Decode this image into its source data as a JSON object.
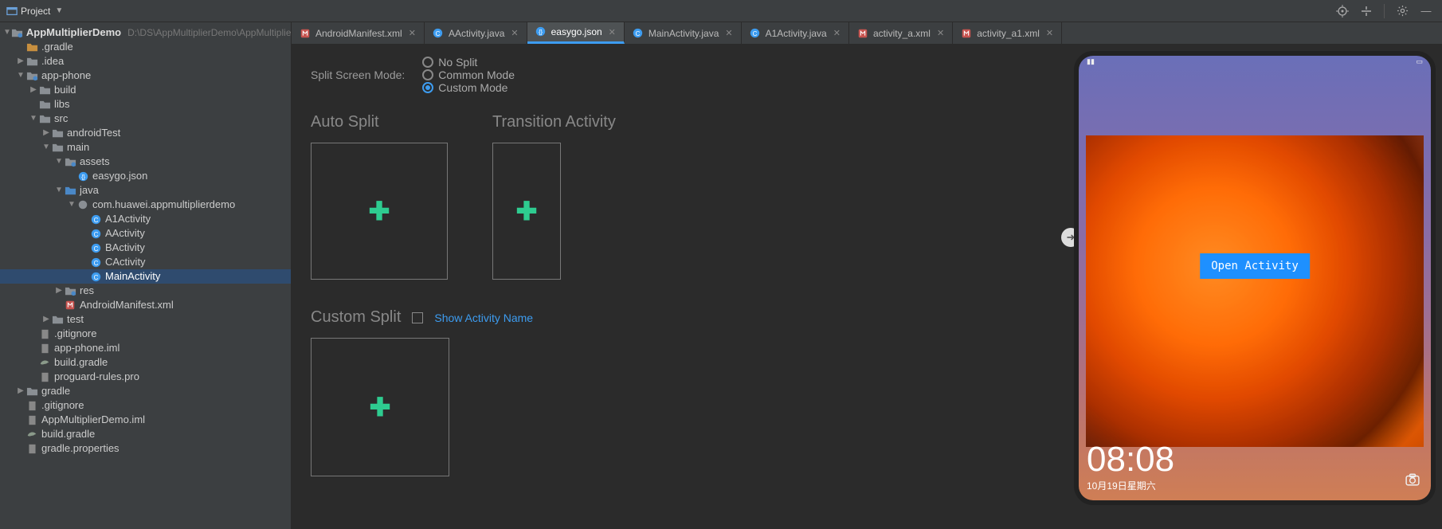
{
  "toolbar": {
    "project": "Project"
  },
  "tree": {
    "root": {
      "name": "AppMultiplierDemo",
      "path": "D:\\DS\\AppMultiplierDemo\\AppMultiplierDemo"
    },
    "items": [
      {
        "indent": 1,
        "arrow": "none",
        "icon": "folder-orange",
        "label": ".gradle"
      },
      {
        "indent": 1,
        "arrow": "right",
        "icon": "folder",
        "label": ".idea"
      },
      {
        "indent": 1,
        "arrow": "down",
        "icon": "module",
        "label": "app-phone"
      },
      {
        "indent": 2,
        "arrow": "right",
        "icon": "folder",
        "label": "build"
      },
      {
        "indent": 2,
        "arrow": "none",
        "icon": "folder",
        "label": "libs"
      },
      {
        "indent": 2,
        "arrow": "down",
        "icon": "folder",
        "label": "src"
      },
      {
        "indent": 3,
        "arrow": "right",
        "icon": "folder",
        "label": "androidTest"
      },
      {
        "indent": 3,
        "arrow": "down",
        "icon": "folder",
        "label": "main"
      },
      {
        "indent": 4,
        "arrow": "down",
        "icon": "module",
        "label": "assets"
      },
      {
        "indent": 5,
        "arrow": "none",
        "icon": "json",
        "label": "easygo.json"
      },
      {
        "indent": 4,
        "arrow": "down",
        "icon": "folder-blue",
        "label": "java"
      },
      {
        "indent": 5,
        "arrow": "down",
        "icon": "package",
        "label": "com.huawei.appmultiplierdemo"
      },
      {
        "indent": 6,
        "arrow": "none",
        "icon": "class",
        "label": "A1Activity"
      },
      {
        "indent": 6,
        "arrow": "none",
        "icon": "class",
        "label": "AActivity"
      },
      {
        "indent": 6,
        "arrow": "none",
        "icon": "class",
        "label": "BActivity"
      },
      {
        "indent": 6,
        "arrow": "none",
        "icon": "class",
        "label": "CActivity"
      },
      {
        "indent": 6,
        "arrow": "none",
        "icon": "class",
        "label": "MainActivity",
        "selected": true
      },
      {
        "indent": 4,
        "arrow": "right",
        "icon": "module",
        "label": "res"
      },
      {
        "indent": 4,
        "arrow": "none",
        "icon": "xml",
        "label": "AndroidManifest.xml"
      },
      {
        "indent": 3,
        "arrow": "right",
        "icon": "folder",
        "label": "test"
      },
      {
        "indent": 2,
        "arrow": "none",
        "icon": "file",
        "label": ".gitignore"
      },
      {
        "indent": 2,
        "arrow": "none",
        "icon": "file",
        "label": "app-phone.iml"
      },
      {
        "indent": 2,
        "arrow": "none",
        "icon": "gradle",
        "label": "build.gradle"
      },
      {
        "indent": 2,
        "arrow": "none",
        "icon": "file",
        "label": "proguard-rules.pro"
      },
      {
        "indent": 1,
        "arrow": "right",
        "icon": "folder",
        "label": "gradle"
      },
      {
        "indent": 1,
        "arrow": "none",
        "icon": "file",
        "label": ".gitignore"
      },
      {
        "indent": 1,
        "arrow": "none",
        "icon": "file",
        "label": "AppMultiplierDemo.iml"
      },
      {
        "indent": 1,
        "arrow": "none",
        "icon": "gradle",
        "label": "build.gradle"
      },
      {
        "indent": 1,
        "arrow": "none",
        "icon": "file",
        "label": "gradle.properties"
      }
    ]
  },
  "tabs": [
    {
      "icon": "xml",
      "label": "AndroidManifest.xml"
    },
    {
      "icon": "class",
      "label": "AActivity.java"
    },
    {
      "icon": "json",
      "label": "easygo.json",
      "active": true
    },
    {
      "icon": "class",
      "label": "MainActivity.java"
    },
    {
      "icon": "class",
      "label": "A1Activity.java"
    },
    {
      "icon": "xml",
      "label": "activity_a.xml"
    },
    {
      "icon": "xml",
      "label": "activity_a1.xml"
    }
  ],
  "config": {
    "modeLabel": "Split Screen Mode:",
    "modes": [
      "No Split",
      "Common Mode",
      "Custom Mode"
    ],
    "selectedMode": 2,
    "autoSplit": "Auto Split",
    "transition": "Transition Activity",
    "customSplit": "Custom Split",
    "showActivityName": "Show Activity Name"
  },
  "preview": {
    "openActivity": "Open Activity",
    "time": "08:08",
    "date": "10月19日星期六"
  }
}
